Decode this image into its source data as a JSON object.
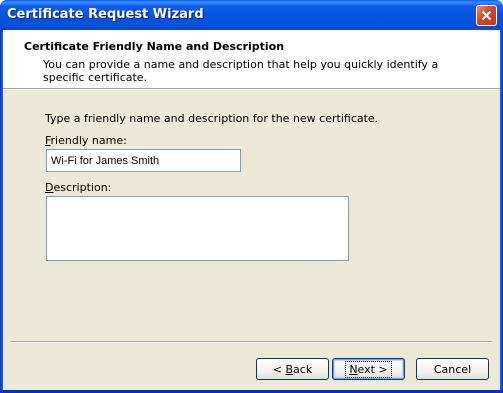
{
  "window": {
    "title": "Certificate Request Wizard"
  },
  "header": {
    "title": "Certificate Friendly Name and Description",
    "description": "You can provide a name and description that help you quickly identify a specific certificate."
  },
  "form": {
    "instruction": "Type a friendly name and description for the new certificate.",
    "friendly_name_label_mnemonic": "F",
    "friendly_name_label_rest": "riendly name:",
    "friendly_name_value": "Wi-Fi for James Smith",
    "description_label_mnemonic": "D",
    "description_label_rest": "escription:",
    "description_value": ""
  },
  "buttons": {
    "back_prefix": "< ",
    "back_mnemonic": "B",
    "back_rest": "ack",
    "next_mnemonic": "N",
    "next_rest": "ext >",
    "cancel": "Cancel"
  },
  "icons": {
    "close": "close-icon"
  },
  "colors": {
    "titlebar": "#0653e0",
    "body": "#ece9d8",
    "close_button": "#d6452a",
    "input_border": "#7f9db9",
    "button_border": "#003c74"
  }
}
